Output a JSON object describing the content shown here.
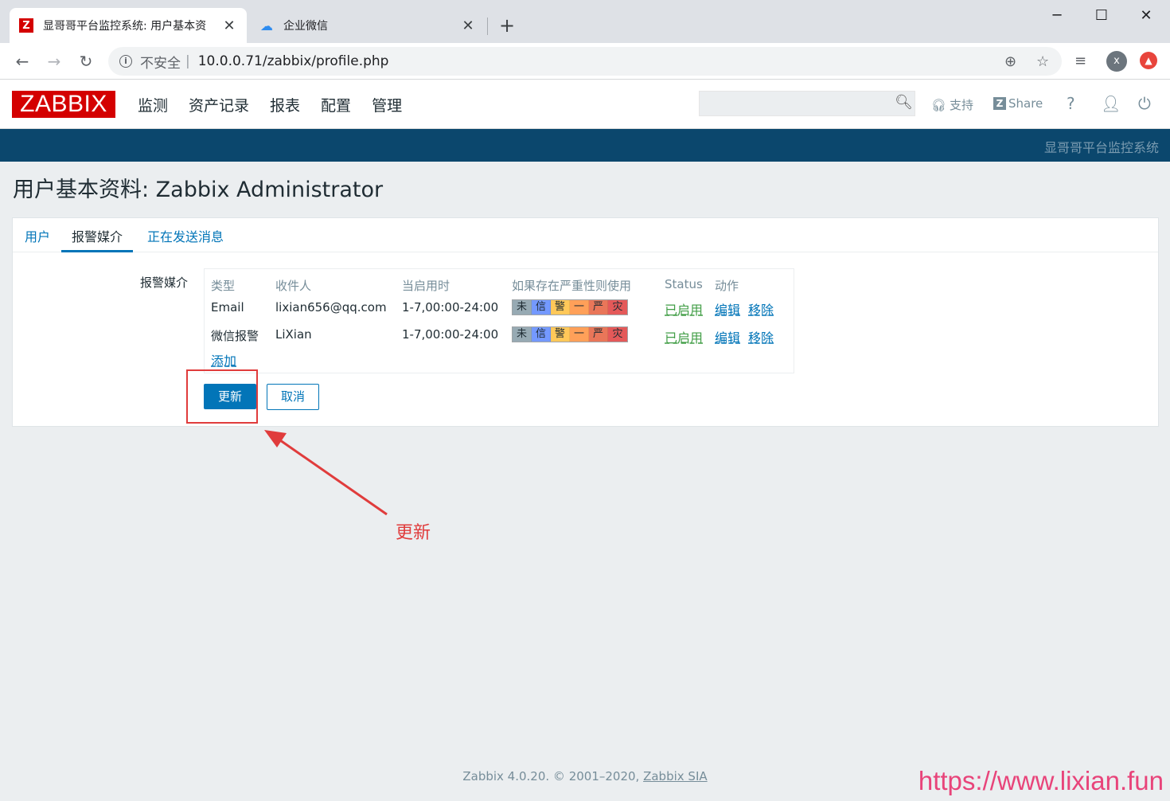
{
  "browser": {
    "tabs": [
      {
        "title": "显哥哥平台监控系统: 用户基本资",
        "favicon": "Z",
        "active": true
      },
      {
        "title": "企业微信",
        "active": false
      }
    ],
    "security_label": "不安全",
    "url": "10.0.0.71/zabbix/profile.php",
    "profile_initial": "x"
  },
  "header": {
    "logo": "ZABBIX",
    "menu": [
      "监测",
      "资产记录",
      "报表",
      "配置",
      "管理"
    ],
    "search_placeholder": "",
    "support_label": "支持",
    "share_label": "Share",
    "help_label": "?",
    "banner_text": "显哥哥平台监控系统"
  },
  "page": {
    "title": "用户基本资料: Zabbix Administrator",
    "tabs": [
      "用户",
      "报警媒介",
      "正在发送消息"
    ],
    "selected_tab": "报警媒介",
    "field_label": "报警媒介",
    "media_columns": [
      "类型",
      "收件人",
      "当启用时",
      "如果存在严重性则使用",
      "Status",
      "动作"
    ],
    "media_rows": [
      {
        "type": "Email",
        "recipient": "lixian656@qq.com",
        "when_active": "1-7,00:00-24:00",
        "status": "已启用",
        "edit": "编辑",
        "remove": "移除"
      },
      {
        "type": "微信报警",
        "recipient": "LiXian",
        "when_active": "1-7,00:00-24:00",
        "status": "已启用",
        "edit": "编辑",
        "remove": "移除"
      }
    ],
    "severity_labels": [
      "未",
      "信",
      "警",
      "一",
      "严",
      "灾"
    ],
    "severity_colors": [
      "#97aab3",
      "#7499ff",
      "#ffc859",
      "#ffa059",
      "#e97659",
      "#e45959"
    ],
    "add_label": "添加",
    "update_button": "更新",
    "cancel_button": "取消"
  },
  "annotation": {
    "text": "更新",
    "color": "#e03c3c"
  },
  "footer": {
    "text": "Zabbix 4.0.20. © 2001–2020,",
    "link": "Zabbix SIA"
  },
  "watermark": "https://www.lixian.fun"
}
